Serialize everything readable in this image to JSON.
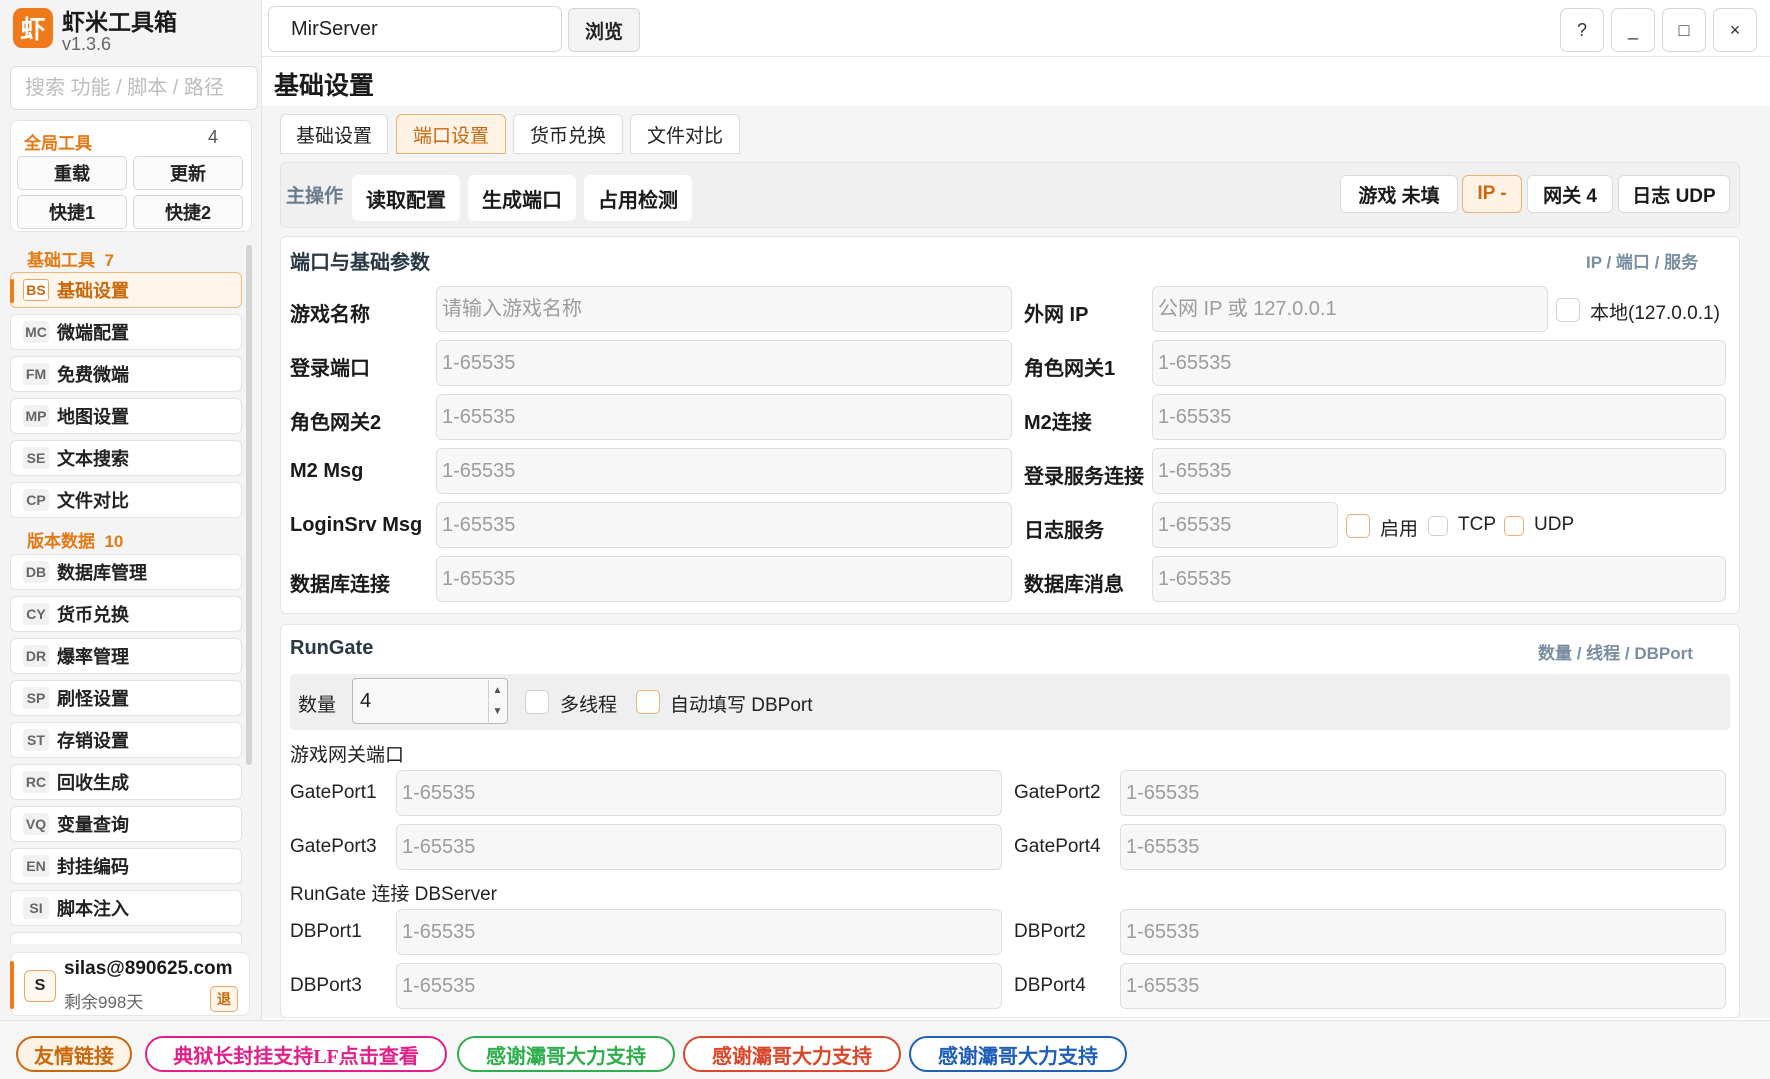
{
  "app": {
    "logo_char": "虾",
    "title": "虾米工具箱",
    "version": "v1.3.6"
  },
  "search": {
    "placeholder": "搜索 功能 / 脚本 / 路径"
  },
  "global_tools": {
    "title": "全局工具",
    "count": "4",
    "buttons": [
      "重载",
      "更新",
      "快捷1",
      "快捷2"
    ]
  },
  "sidebar": {
    "section_basic": "基础工具",
    "section_basic_count": "7",
    "section_version": "版本数据",
    "section_version_count": "10",
    "items": [
      {
        "code": "BS",
        "label": "基础设置"
      },
      {
        "code": "MC",
        "label": "微端配置"
      },
      {
        "code": "FM",
        "label": "免费微端"
      },
      {
        "code": "MP",
        "label": "地图设置"
      },
      {
        "code": "SE",
        "label": "文本搜索"
      },
      {
        "code": "CP",
        "label": "文件对比"
      },
      {
        "code": "DB",
        "label": "数据库管理"
      },
      {
        "code": "CY",
        "label": "货币兑换"
      },
      {
        "code": "DR",
        "label": "爆率管理"
      },
      {
        "code": "SP",
        "label": "刷怪设置"
      },
      {
        "code": "ST",
        "label": "存销设置"
      },
      {
        "code": "RC",
        "label": "回收生成"
      },
      {
        "code": "VQ",
        "label": "变量查询"
      },
      {
        "code": "EN",
        "label": "封挂编码"
      },
      {
        "code": "SI",
        "label": "脚本注入"
      }
    ]
  },
  "user": {
    "avatar": "S",
    "email": "silas@890625.com",
    "days": "剩余998天",
    "logout": "退"
  },
  "topbar": {
    "path_value": "MirServer",
    "browse": "浏览",
    "help": "?",
    "minimize": "_",
    "maximize": "□",
    "close": "×"
  },
  "page_title": "基础设置",
  "tabs": [
    "基础设置",
    "端口设置",
    "货币兑换",
    "文件对比"
  ],
  "ops": {
    "label": "主操作",
    "buttons": [
      "读取配置",
      "生成端口",
      "占用检测"
    ],
    "stats": [
      "游戏 未填",
      "IP -",
      "网关 4",
      "日志 UDP"
    ]
  },
  "ports_card": {
    "title": "端口与基础参数",
    "hint": "IP / 端口 / 服务",
    "port_placeholder": "1-65535",
    "game_name": {
      "label": "游戏名称",
      "placeholder": "请输入游戏名称"
    },
    "wan_ip": {
      "label": "外网 IP",
      "placeholder": "公网 IP 或 127.0.0.1",
      "local_label": "本地(127.0.0.1)"
    },
    "login_port": "登录端口",
    "role_gw1": "角色网关1",
    "role_gw2": "角色网关2",
    "m2_conn": "M2连接",
    "m2_msg": "M2 Msg",
    "login_srv_conn": "登录服务连接",
    "loginsrv_msg": "LoginSrv Msg",
    "log_service": "日志服务",
    "log_enable": "启用",
    "log_tcp": "TCP",
    "log_udp": "UDP",
    "db_conn": "数据库连接",
    "db_msg": "数据库消息"
  },
  "rungate": {
    "title": "RunGate",
    "hint": "数量 / 线程 / DBPort",
    "qty_label": "数量",
    "qty_value": "4",
    "multithread": "多线程",
    "autofill": "自动填写 DBPort",
    "gate_section": "游戏网关端口",
    "gate_labels": [
      "GatePort1",
      "GatePort2",
      "GatePort3",
      "GatePort4"
    ],
    "db_section": "RunGate 连接 DBServer",
    "db_labels": [
      "DBPort1",
      "DBPort2",
      "DBPort3",
      "DBPort4"
    ]
  },
  "footer": {
    "links": [
      {
        "text": "友情链接",
        "color": "#c9690e"
      },
      {
        "text": "典狱长封挂支持LF点击查看",
        "color": "#e0208a"
      },
      {
        "text": "感谢灞哥大力支持",
        "color": "#2fae4e"
      },
      {
        "text": "感谢灞哥大力支持",
        "color": "#d9482b"
      },
      {
        "text": "感谢灞哥大力支持",
        "color": "#1f5fb8"
      }
    ]
  },
  "colors": {
    "accent": "#f07a1a",
    "accent_text": "#c9690e"
  }
}
